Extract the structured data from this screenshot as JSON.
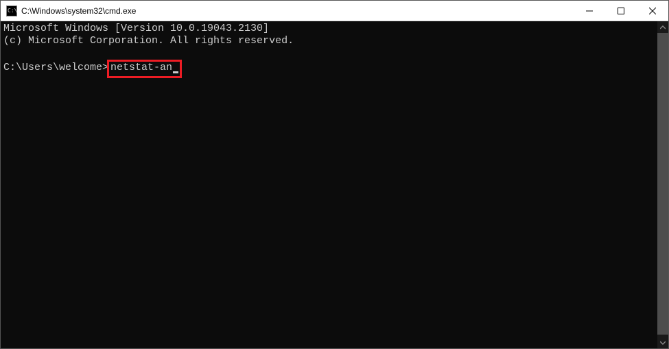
{
  "window": {
    "title": "C:\\Windows\\system32\\cmd.exe",
    "icon_label": "cmd-icon"
  },
  "terminal": {
    "line1": "Microsoft Windows [Version 10.0.19043.2130]",
    "line2": "(c) Microsoft Corporation. All rights reserved.",
    "prompt": "C:\\Users\\welcome>",
    "command": "netstat-an"
  },
  "controls": {
    "minimize": "Minimize",
    "maximize": "Maximize",
    "close": "Close"
  }
}
